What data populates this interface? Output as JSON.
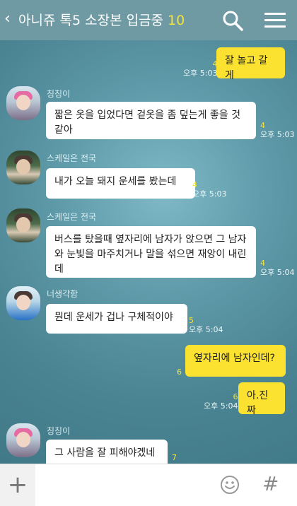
{
  "header": {
    "back_icon": "‹",
    "title": "아니쥬 톡5 소장본 입금중",
    "member_count": "10"
  },
  "messages": [
    {
      "from": "me",
      "text": "잘 놀고 갈게",
      "unread": "4",
      "time": "오후 5:03"
    },
    {
      "from": "칭칭이",
      "text": "짧은 옷을 입었다면 겉옷을 좀 덮는게 좋을 것 같아",
      "unread": "4",
      "time": "오후 5:03"
    },
    {
      "from": "스케일은 전국",
      "text": "내가 오늘 돼지 운세를 봤는데",
      "unread": "4",
      "time": "오후 5:03"
    },
    {
      "from": "스케일은 전국",
      "text": "버스를 탔을때 옆자리에 남자가 앉으면 그 남자와 눈빛을 마주치거나 말을 섞으면 재앙이 내린데",
      "unread": "4",
      "time": "오후 5:04"
    },
    {
      "from": "너생각함",
      "text": "뭔데 운세가 겁나 구체적이야",
      "unread": "5",
      "time": "오후 5:04"
    },
    {
      "from": "me",
      "text": "옆자리에 남자인데?",
      "unread": "6",
      "time": ""
    },
    {
      "from": "me",
      "text": "아.진짜",
      "unread": "6",
      "time": "오후 5:04"
    },
    {
      "from": "칭칭이",
      "text": "그 사람을 잘 피해야겠네",
      "unread": "7",
      "time": ""
    }
  ],
  "input": {
    "placeholder": "",
    "plus_icon": "+",
    "hash_icon": "#"
  },
  "colors": {
    "header": "#6f9aa4",
    "my_bubble": "#fbe231",
    "their_bubble": "#ffffff",
    "unread": "#f4e33a"
  }
}
